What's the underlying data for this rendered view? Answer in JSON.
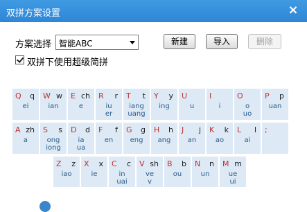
{
  "window": {
    "title": "双拼方案设置",
    "close_icon": "close-icon"
  },
  "scheme": {
    "label": "方案选择",
    "selected": "智能ABC"
  },
  "buttons": {
    "new": "新建",
    "import": "导入",
    "delete": "删除"
  },
  "option": {
    "checked": true,
    "label": "双拼下使用超级简拼"
  },
  "keyboard": {
    "rows": [
      [
        {
          "letter": "Q",
          "code": "q",
          "yun": [
            "ei"
          ]
        },
        {
          "letter": "W",
          "code": "w",
          "yun": [
            "ian"
          ]
        },
        {
          "letter": "E",
          "code": "ch",
          "yun": [
            "e"
          ]
        },
        {
          "letter": "R",
          "code": "r",
          "yun": [
            "iu",
            "er"
          ]
        },
        {
          "letter": "T",
          "code": "t",
          "yun": [
            "iang",
            "uang"
          ]
        },
        {
          "letter": "Y",
          "code": "y",
          "yun": [
            "ing"
          ]
        },
        {
          "letter": "U",
          "code": "",
          "yun": [
            "u"
          ]
        },
        {
          "letter": "I",
          "code": "",
          "yun": [
            "i"
          ]
        },
        {
          "letter": "O",
          "code": "",
          "yun": [
            "o",
            "uo"
          ]
        },
        {
          "letter": "P",
          "code": "p",
          "yun": [
            "uan"
          ]
        }
      ],
      [
        {
          "letter": "A",
          "code": "zh",
          "yun": [
            "a"
          ]
        },
        {
          "letter": "S",
          "code": "s",
          "yun": [
            "ong",
            "iong"
          ]
        },
        {
          "letter": "D",
          "code": "d",
          "yun": [
            "ia",
            "ua"
          ]
        },
        {
          "letter": "F",
          "code": "f",
          "yun": [
            "en"
          ]
        },
        {
          "letter": "G",
          "code": "g",
          "yun": [
            "eng"
          ]
        },
        {
          "letter": "H",
          "code": "h",
          "yun": [
            "ang"
          ]
        },
        {
          "letter": "J",
          "code": "j",
          "yun": [
            "an"
          ]
        },
        {
          "letter": "K",
          "code": "k",
          "yun": [
            "ao"
          ]
        },
        {
          "letter": "L",
          "code": "l",
          "yun": [
            "ai"
          ]
        },
        {
          "letter": ";",
          "code": "",
          "yun": []
        }
      ],
      [
        {
          "letter": "Z",
          "code": "z",
          "yun": [
            "iao"
          ]
        },
        {
          "letter": "X",
          "code": "x",
          "yun": [
            "ie"
          ]
        },
        {
          "letter": "C",
          "code": "c",
          "yun": [
            "in",
            "uai"
          ]
        },
        {
          "letter": "V",
          "code": "sh",
          "yun": [
            "ve",
            "v"
          ]
        },
        {
          "letter": "B",
          "code": "b",
          "yun": [
            "ou"
          ]
        },
        {
          "letter": "N",
          "code": "n",
          "yun": [
            "un"
          ]
        },
        {
          "letter": "M",
          "code": "m",
          "yun": [
            "ue",
            "ui"
          ]
        }
      ]
    ]
  }
}
